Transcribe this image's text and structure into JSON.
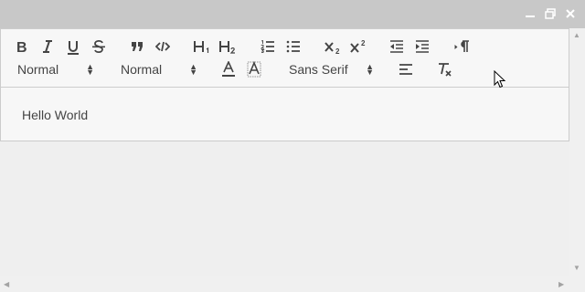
{
  "window": {
    "minimize_icon": "minimize-icon",
    "restore_icon": "restore-icon",
    "close_icon": "close-icon"
  },
  "toolbar": {
    "row1": [
      {
        "name": "bold-button",
        "icon": "bold-icon"
      },
      {
        "name": "italic-button",
        "icon": "italic-icon"
      },
      {
        "name": "underline-button",
        "icon": "underline-icon"
      },
      {
        "name": "strike-button",
        "icon": "strike-icon"
      },
      {
        "name": "blockquote-button",
        "icon": "quote-icon"
      },
      {
        "name": "code-block-button",
        "icon": "code-icon"
      },
      {
        "name": "header1-button",
        "icon": "h1-icon"
      },
      {
        "name": "header2-button",
        "icon": "h2-icon"
      },
      {
        "name": "ordered-list-button",
        "icon": "ordered-list-icon"
      },
      {
        "name": "bullet-list-button",
        "icon": "bullet-list-icon"
      },
      {
        "name": "subscript-button",
        "icon": "subscript-icon"
      },
      {
        "name": "superscript-button",
        "icon": "superscript-icon"
      },
      {
        "name": "outdent-button",
        "icon": "outdent-icon"
      },
      {
        "name": "indent-button",
        "icon": "indent-icon"
      },
      {
        "name": "direction-rtl-button",
        "icon": "rtl-icon"
      }
    ],
    "size_picker": "Normal",
    "header_picker": "Normal",
    "font_picker": "Sans Serif",
    "color_icon": "text-color-icon",
    "background_icon": "background-color-icon",
    "align_icon": "align-icon",
    "clean_icon": "clear-format-icon"
  },
  "editor": {
    "content": "Hello World"
  },
  "colors": {
    "titlebar": "#c8c8c8",
    "background": "#efefef",
    "editor_bg": "#f7f7f7",
    "border": "#cccccc",
    "icon": "#444444"
  }
}
